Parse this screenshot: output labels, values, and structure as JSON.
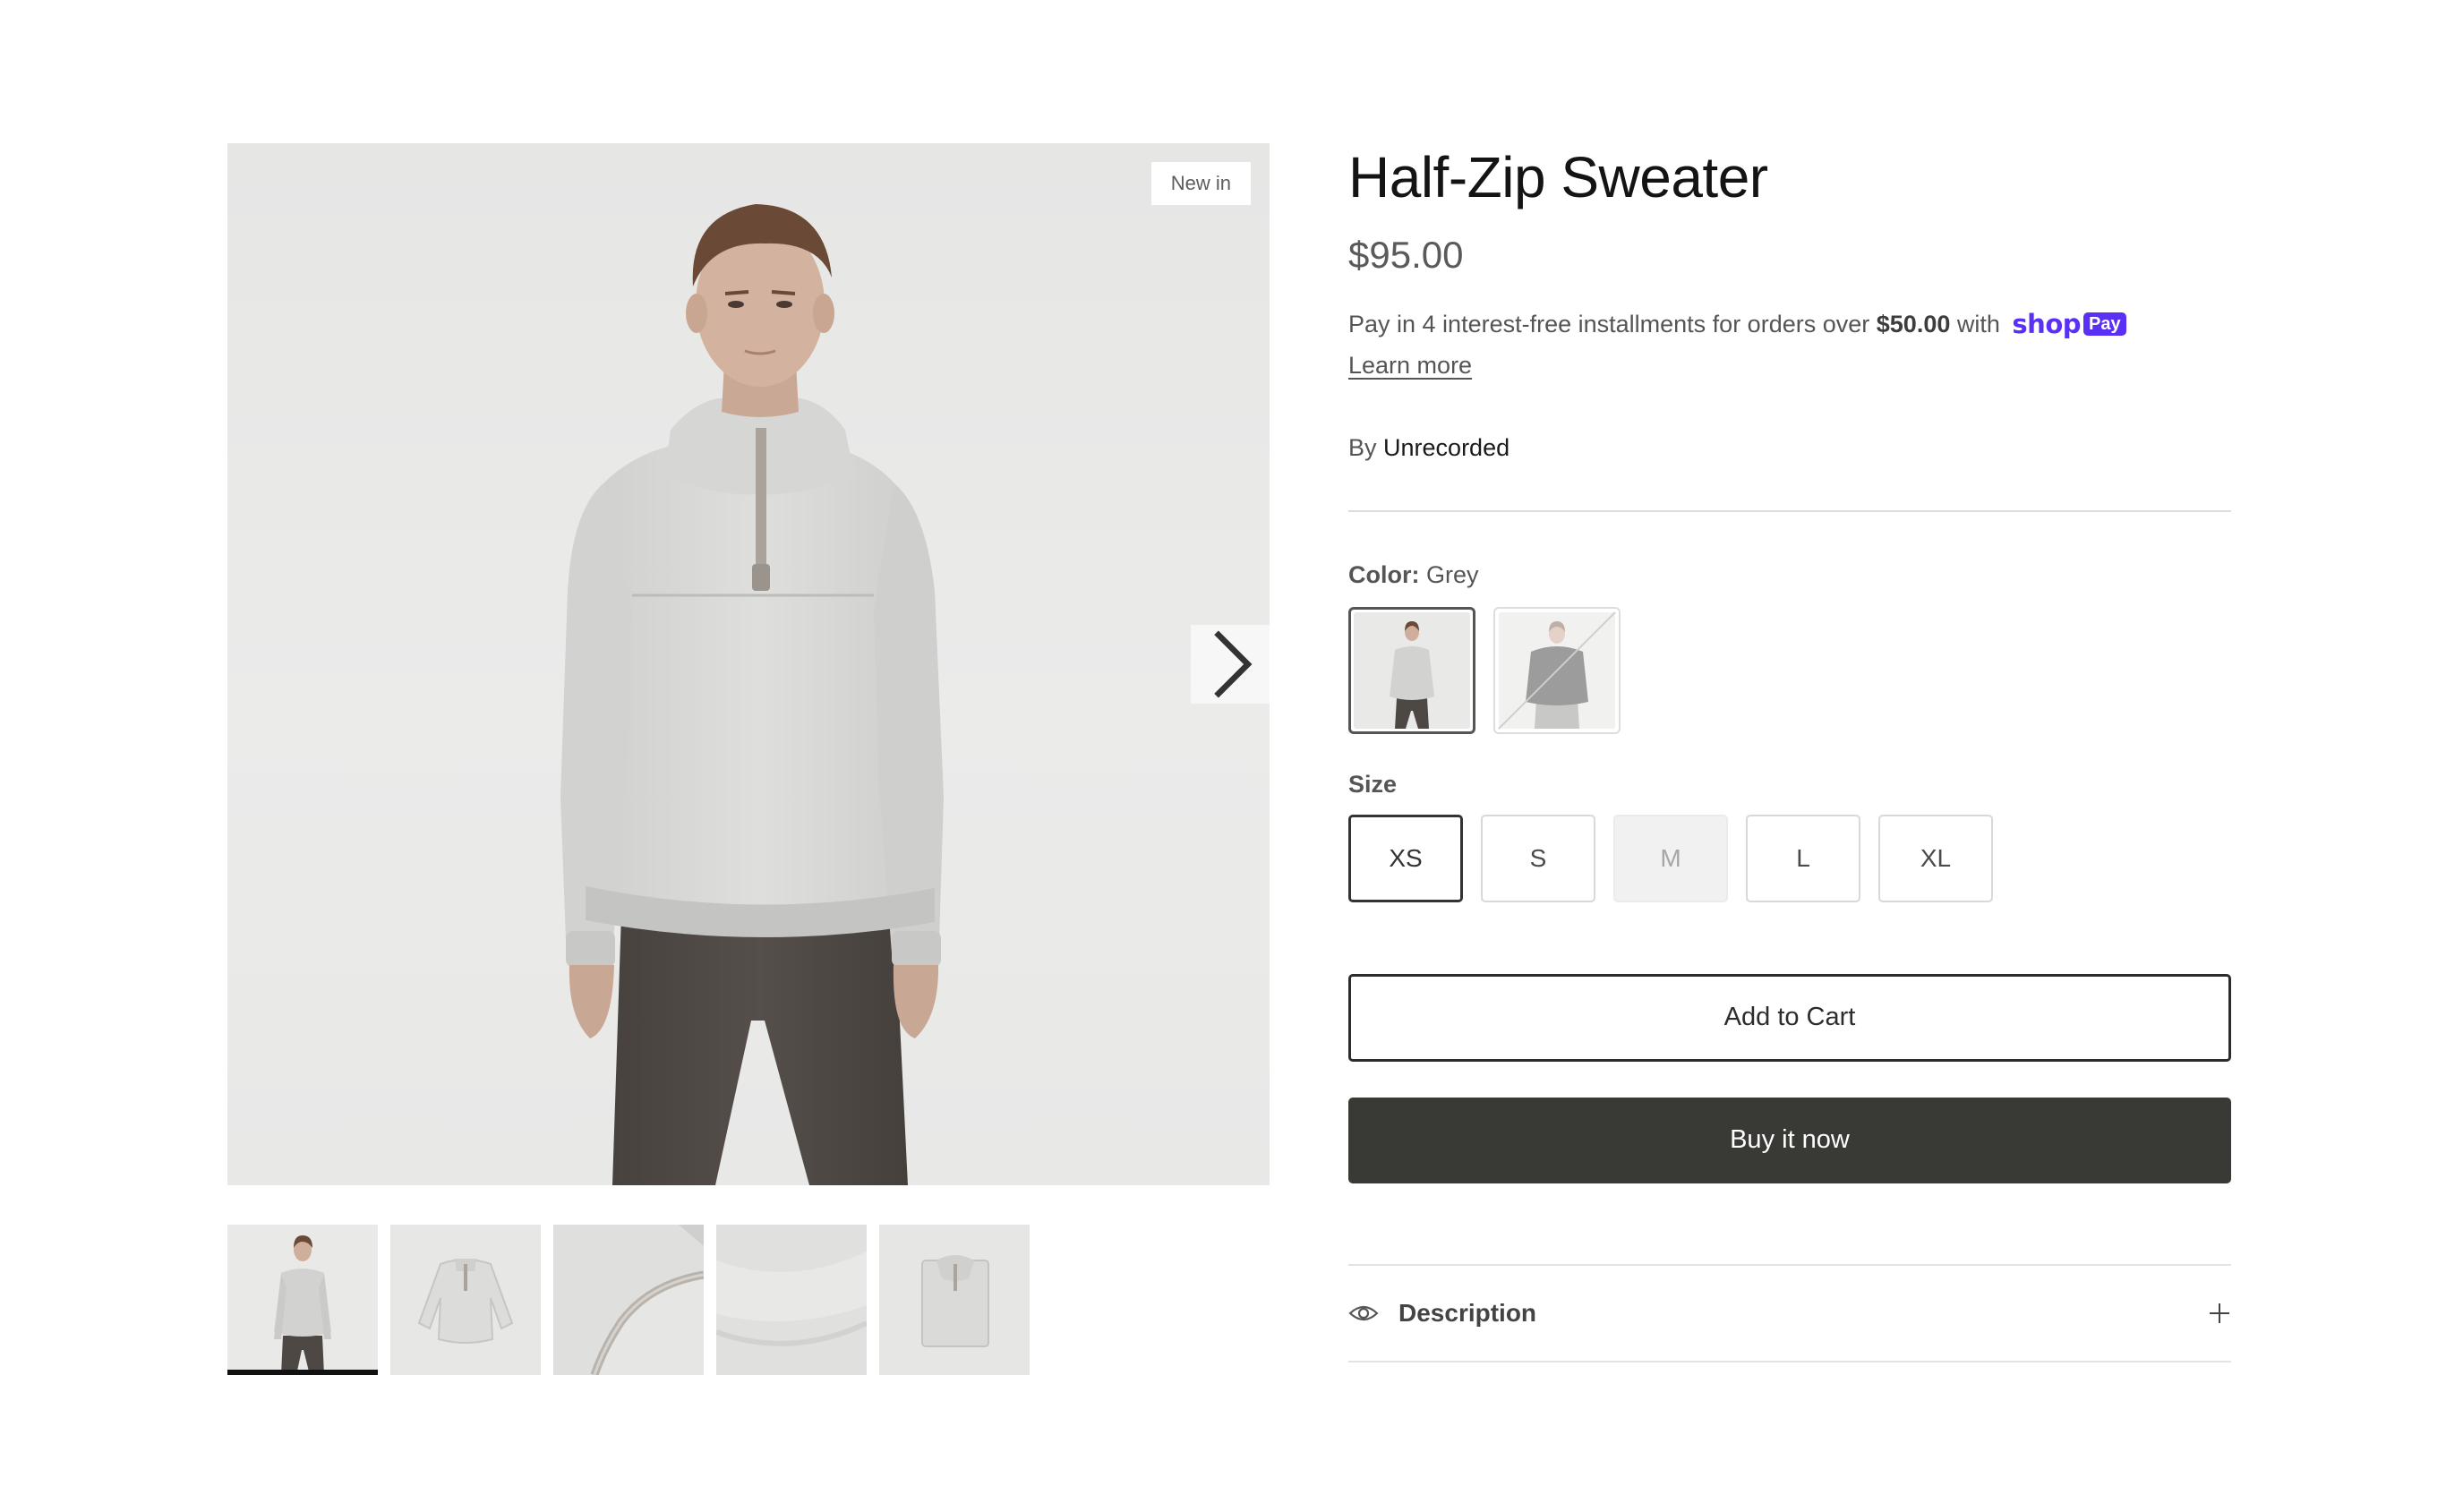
{
  "gallery": {
    "badge": "New in",
    "next_icon": "chevron-right-icon",
    "thumbnails": [
      {
        "name": "thumb-model-front",
        "active": true
      },
      {
        "name": "thumb-sweater-flat",
        "active": false
      },
      {
        "name": "thumb-zipper-detail",
        "active": false
      },
      {
        "name": "thumb-fabric-texture",
        "active": false
      },
      {
        "name": "thumb-sweater-folded",
        "active": false
      }
    ]
  },
  "product": {
    "title": "Half-Zip Sweater",
    "price": "$95.00",
    "installments": {
      "prefix": "Pay in 4 interest-free installments for orders over",
      "amount": "$50.00",
      "suffix": "with",
      "brand_shop": "shop",
      "brand_pay": "Pay",
      "learn_more": "Learn more"
    },
    "vendor": {
      "label": "By",
      "name": "Unrecorded"
    },
    "color": {
      "label": "Color:",
      "value": "Grey",
      "swatches": [
        {
          "name": "Grey",
          "selected": true,
          "available": true
        },
        {
          "name": "Charcoal",
          "selected": false,
          "available": false
        }
      ]
    },
    "size": {
      "label": "Size",
      "options": [
        {
          "label": "XS",
          "selected": true,
          "available": true
        },
        {
          "label": "S",
          "selected": false,
          "available": true
        },
        {
          "label": "M",
          "selected": false,
          "available": false
        },
        {
          "label": "L",
          "selected": false,
          "available": true
        },
        {
          "label": "XL",
          "selected": false,
          "available": true
        }
      ]
    },
    "add_to_cart": "Add to Cart",
    "buy_now": "Buy it now",
    "description": {
      "label": "Description",
      "icon": "eye-icon",
      "toggle_icon": "plus-icon"
    }
  },
  "colors": {
    "shop_pay": "#5a31f4",
    "buy_now_bg": "#393a35",
    "sweater_grey": "#d9d9d7",
    "trousers": "#4e4844"
  }
}
